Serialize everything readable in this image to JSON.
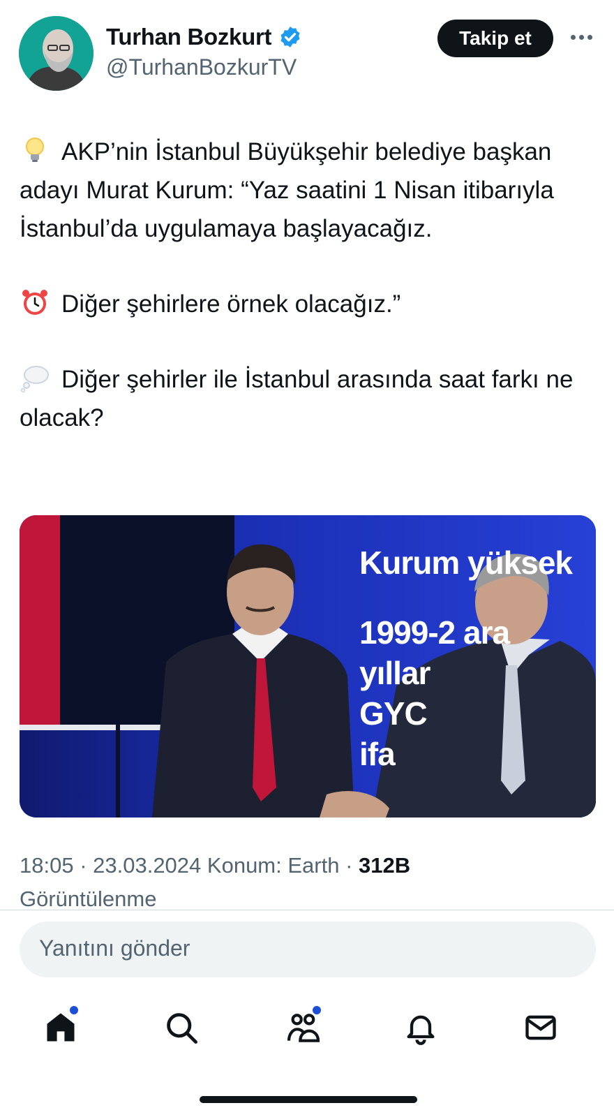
{
  "header": {
    "name": "Turhan Bozkurt",
    "handle": "@TurhanBozkurTV",
    "follow_label": "Takip et"
  },
  "tweet": {
    "p1": "AKP’nin İstanbul Büyükşehir belediye başkan adayı Murat Kurum: “Yaz saatini 1 Nisan itibarıyla İstanbul’da uygulamaya başlayacağız.",
    "p2": "Diğer şehirlere örnek olacağız.”",
    "p3": "Diğer şehirler ile İstanbul arasında saat farkı ne olacak?"
  },
  "media": {
    "screen_line1": "Kurum  yüksek",
    "screen_line2": "1999-2    ara",
    "screen_line3": "yıllar",
    "screen_line4": "GYC",
    "screen_line5": "ifa"
  },
  "meta": {
    "time_date": "18:05 · 23.03.2024",
    "location": "Konum: Earth",
    "views_count": "312B",
    "views_label": "Görüntülenme"
  },
  "reply": {
    "placeholder": "Yanıtını gönder"
  },
  "nav": {
    "items": [
      "home-icon",
      "search-icon",
      "communities-icon",
      "notifications-icon",
      "messages-icon"
    ]
  },
  "colors": {
    "accent": "#1d9bf0",
    "text": "#0f1419",
    "muted": "#536471",
    "avatar_bg": "#12a394"
  }
}
